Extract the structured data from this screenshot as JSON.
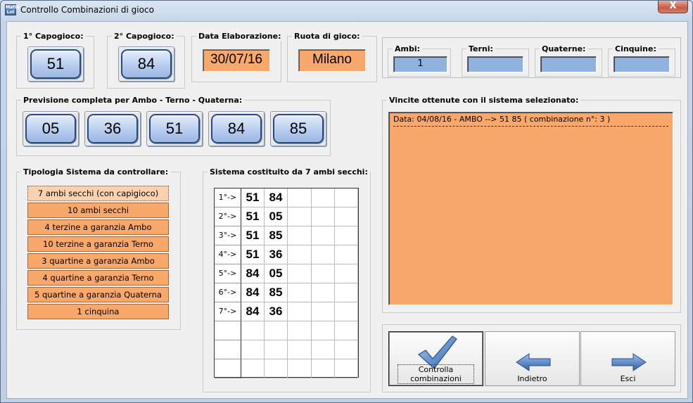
{
  "window": {
    "title": "Controllo Combinazioni di gioco",
    "icon_text": "Matte Lot",
    "close_glyph": "X"
  },
  "capogioco1": {
    "label": "1° Capogioco:",
    "value": "51"
  },
  "capogioco2": {
    "label": "2° Capogioco:",
    "value": "84"
  },
  "data_elaborazione": {
    "label": "Data Elaborazione:",
    "value": "30/07/16"
  },
  "ruota": {
    "label": "Ruota di gioco:",
    "value": "Milano"
  },
  "counts": {
    "ambi": {
      "label": "Ambi:",
      "value": "1"
    },
    "terni": {
      "label": "Terni:",
      "value": ""
    },
    "quaterne": {
      "label": "Quaterne:",
      "value": ""
    },
    "cinquine": {
      "label": "Cinquine:",
      "value": ""
    }
  },
  "previsione": {
    "label": "Previsione completa per Ambo - Terno - Quaterna:",
    "numbers": [
      "05",
      "36",
      "51",
      "84",
      "85"
    ]
  },
  "tipologia": {
    "label": "Tipologia Sistema da controllare:",
    "options": [
      "7 ambi secchi (con capigioco)",
      "10 ambi secchi",
      "4 terzine a garanzia Ambo",
      "10 terzine a garanzia Terno",
      "3 quartine a garanzia Ambo",
      "4 quartine a garanzia Terno",
      "5 quartine a garanzia Quaterna",
      "1 cinquina"
    ],
    "selected_index": 0
  },
  "sistema": {
    "label": "Sistema costituito da 7 ambi secchi:",
    "rows": [
      {
        "label": "1°->",
        "a": "51",
        "b": "84"
      },
      {
        "label": "2°->",
        "a": "51",
        "b": "05"
      },
      {
        "label": "3°->",
        "a": "51",
        "b": "85"
      },
      {
        "label": "4°->",
        "a": "51",
        "b": "36"
      },
      {
        "label": "5°->",
        "a": "84",
        "b": "05"
      },
      {
        "label": "6°->",
        "a": "84",
        "b": "85"
      },
      {
        "label": "7°->",
        "a": "84",
        "b": "36"
      },
      {
        "label": "",
        "a": "",
        "b": ""
      },
      {
        "label": "",
        "a": "",
        "b": ""
      },
      {
        "label": "",
        "a": "",
        "b": ""
      }
    ]
  },
  "vincite": {
    "label": "Vincite ottenute con il sistema selezionato:",
    "lines": [
      "Data: 04/08/16 - AMBO --> 51 85  ( combinazione n°: 3 )"
    ]
  },
  "actions": {
    "controlla": "Controlla combinazioni",
    "indietro": "Indietro",
    "esci": "Esci"
  },
  "colors": {
    "orange": "#f9a86c",
    "blue_box": "#8fb3de",
    "check_blue": "#4a82c8",
    "arrow_blue": "#3f6fb8"
  }
}
